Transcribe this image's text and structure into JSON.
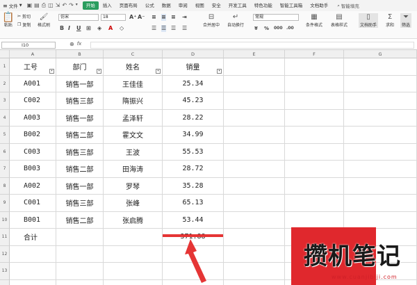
{
  "menubar": {
    "file_label": "文件",
    "tabs": [
      "开始",
      "插入",
      "页面布局",
      "公式",
      "数据",
      "审阅",
      "视图",
      "安全",
      "开发工具",
      "特色功能",
      "智能工具箱",
      "文档助手"
    ],
    "active_tab": "开始",
    "search_label": "智能填充"
  },
  "ribbon": {
    "paste_label": "粘贴",
    "cut_label": "剪切",
    "copy_label": "复制",
    "format_painter_label": "格式刷",
    "font_name": "仿宋",
    "font_size": "18",
    "bold": "B",
    "italic": "I",
    "underline": "U",
    "merge_center_label": "合并居中",
    "auto_wrap_label": "自动换行",
    "number_format": "常规",
    "conditional_format_label": "条件格式",
    "table_style_label": "表格样式",
    "doc_helper_label": "文档助手",
    "sum_label": "求和",
    "filter_label": "筛选"
  },
  "formula_bar": {
    "cell_ref": "I10",
    "formula": ""
  },
  "columns": [
    "A",
    "B",
    "C",
    "D",
    "E",
    "F",
    "G"
  ],
  "rows": [
    "1",
    "2",
    "3",
    "4",
    "5",
    "6",
    "7",
    "8",
    "9",
    "10",
    "11",
    "12",
    "13",
    "14"
  ],
  "table": {
    "headers": [
      "工号",
      "部门",
      "姓名",
      "销量"
    ],
    "data": [
      [
        "A001",
        "销售一部",
        "王佳佳",
        "25.34"
      ],
      [
        "C002",
        "销售三部",
        "隋振兴",
        "45.23"
      ],
      [
        "A003",
        "销售一部",
        "孟泽轩",
        "28.22"
      ],
      [
        "B002",
        "销售二部",
        "霍文文",
        "34.99"
      ],
      [
        "C003",
        "销售三部",
        "王波",
        "55.53"
      ],
      [
        "B003",
        "销售二部",
        "田海涛",
        "28.72"
      ],
      [
        "A002",
        "销售一部",
        "罗琴",
        "35.28"
      ],
      [
        "C001",
        "销售三部",
        "张峰",
        "65.13"
      ],
      [
        "B001",
        "销售二部",
        "张启腾",
        "53.44"
      ]
    ],
    "total_label": "合计",
    "total_value": "371.88"
  },
  "watermark": {
    "text": "攒机笔记",
    "url": "www.cuanjibiji.com"
  },
  "colors": {
    "accent": "#2a9d5e",
    "highlight": "#e53535"
  }
}
